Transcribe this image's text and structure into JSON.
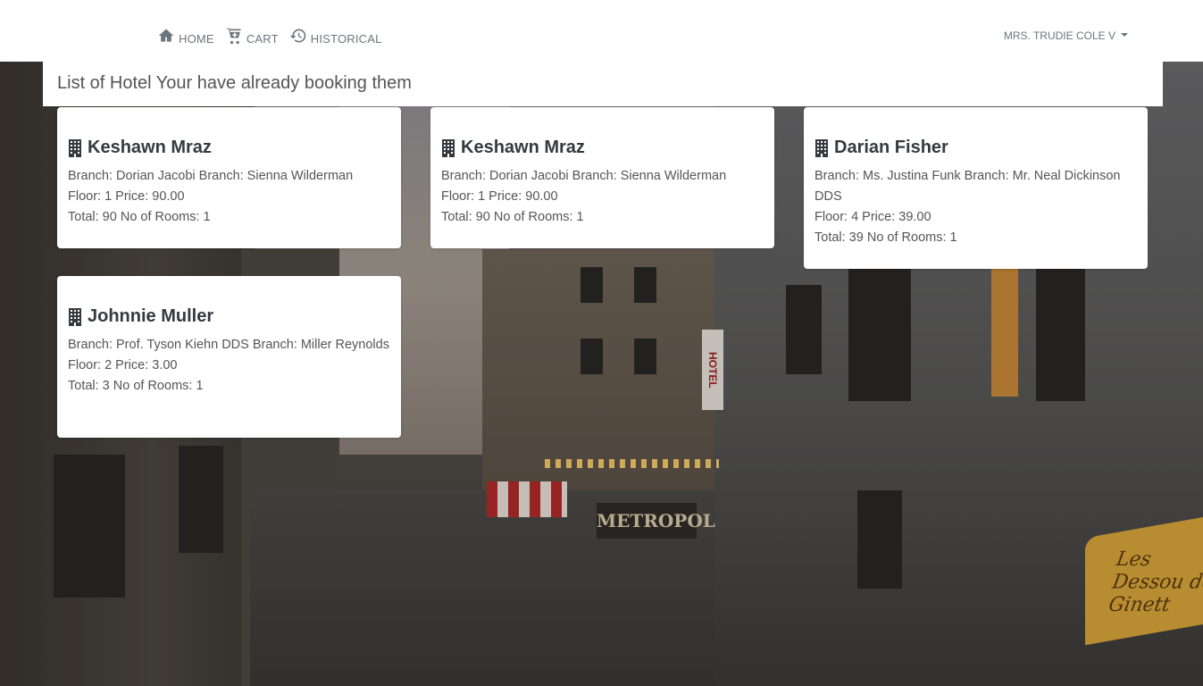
{
  "nav": {
    "home": "HOME",
    "cart": "CART",
    "historical": "HISTORICAL",
    "user": "MRS. TRUDIE COLE V"
  },
  "page": {
    "heading": "List of Hotel Your have already booking them"
  },
  "background": {
    "hotel_sign": "HOTEL",
    "metropol_sign": "METROPOL",
    "awning_text": "Les Dessou de Ginett"
  },
  "bookings": [
    {
      "name": "Keshawn Mraz",
      "branch_line": "Branch: Dorian Jacobi Branch: Sienna Wilderman",
      "floor_price": "Floor: 1 Price: 90.00",
      "total_rooms": "Total: 90 No of Rooms: 1"
    },
    {
      "name": "Keshawn Mraz",
      "branch_line": "Branch: Dorian Jacobi Branch: Sienna Wilderman",
      "floor_price": "Floor: 1 Price: 90.00",
      "total_rooms": "Total: 90 No of Rooms: 1"
    },
    {
      "name": "Darian Fisher",
      "branch_line": "Branch: Ms. Justina Funk Branch: Mr. Neal Dickinson DDS",
      "floor_price": "Floor: 4 Price: 39.00",
      "total_rooms": "Total: 39 No of Rooms: 1"
    },
    {
      "name": "Johnnie Muller",
      "branch_line": "Branch: Prof. Tyson Kiehn DDS Branch: Miller Reynolds",
      "floor_price": "Floor: 2 Price: 3.00",
      "total_rooms": "Total: 3 No of Rooms: 1"
    }
  ]
}
